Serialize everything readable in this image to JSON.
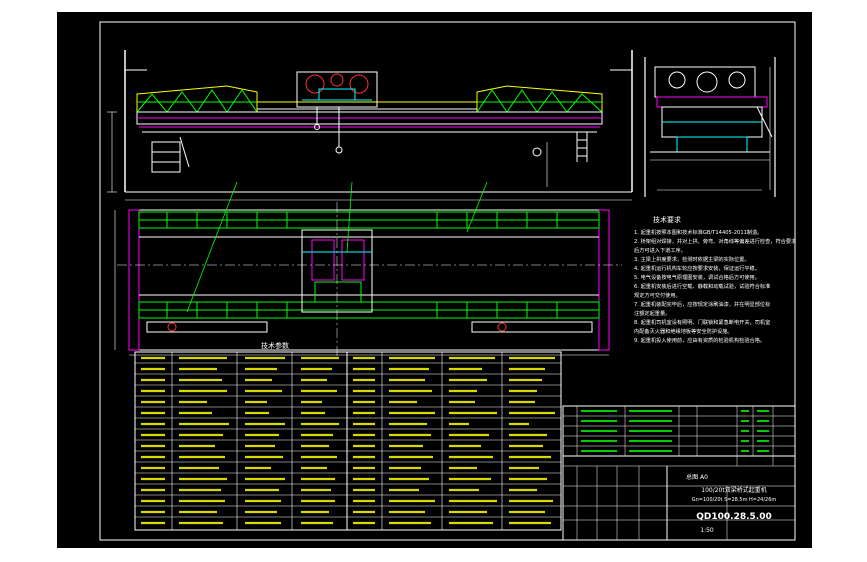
{
  "title_block": {
    "drawing_number": "QD100.28.5.00",
    "scale": "1:50",
    "product_line1": "100/20t双梁桥式起重机",
    "product_line2": "Gn=100/20t S=28.5m H=24/26m",
    "drawing_name": "总图 A0"
  },
  "tech_table_caption": "技术参数",
  "notes_heading": "技术要求",
  "notes": [
    "1. 起重机按照本图和技术标准GB/T14405-2011制造。",
    "2. 桥架组对焊接，并对上拱、旁弯、对角线等偏差进行检查，符合要求",
    "   后方可进入下道工序。",
    "3. 主梁上拱度要求，检测时依据主梁的实际位置。",
    "4. 起重机运行机构车轮应按要求安装，保证运行平稳。",
    "5. 电气设备按电气原理图安装，调试合格后方可使用。",
    "6. 起重机安装后进行空载、静载和动载试验，试验符合标准",
    "   规定方可交付使用。",
    "7. 起重机装配完毕后，应按规定涂刷油漆，并在明显部位标",
    "   注额定起重量。",
    "8. 起重机司机室设有照明、门联锁和紧急断电开关，司机室",
    "   内配备灭火器和绝缘地板等安全防护设施。",
    "9. 起重机投入使用前，应由有资质的检验机构检验合格。"
  ]
}
